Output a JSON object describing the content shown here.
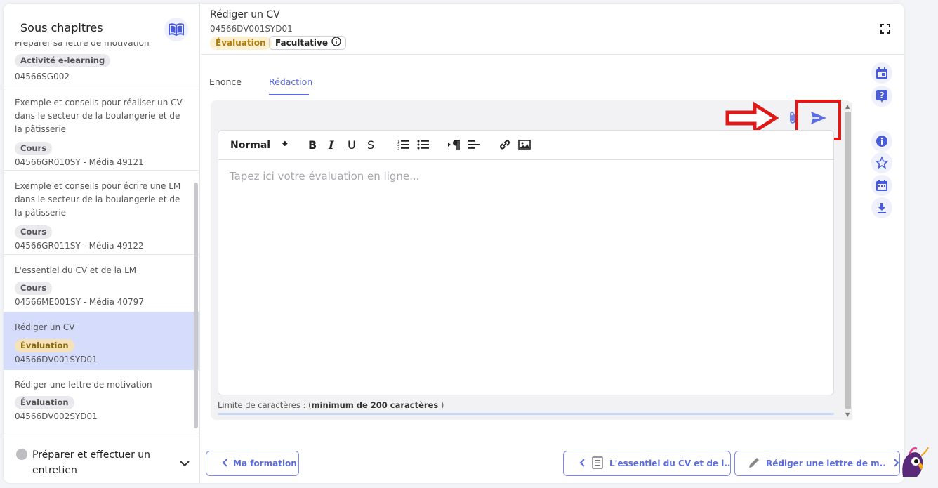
{
  "sidebar": {
    "title": "Sous chapitres",
    "items": [
      {
        "title": "Préparer sa lettre de motivation",
        "badge": "Activité e-learning",
        "code": "04566SG002"
      },
      {
        "title": "Exemple et conseils pour réaliser un CV dans le secteur de la boulangerie et de la pâtisserie",
        "badge": "Cours",
        "code": "04566GR010SY - Média 49121"
      },
      {
        "title": "Exemple et conseils pour écrire une LM dans le secteur de la boulangerie et de la pâtisserie",
        "badge": "Cours",
        "code": "04566GR011SY - Média 49122"
      },
      {
        "title": "L'essentiel du CV et de la LM",
        "badge": "Cours",
        "code": "04566ME001SY - Média 40797"
      },
      {
        "title": "Rédiger un CV",
        "badge": "Évaluation",
        "code": "04566DV001SYD01",
        "active": true
      },
      {
        "title": "Rédiger une lettre de motivation",
        "badge": "Évaluation",
        "code": "04566DV002SYD01"
      }
    ],
    "footer": {
      "label": "Préparer et effectuer un entretien"
    }
  },
  "header": {
    "title": "Rédiger un CV",
    "code": "04566DV001SYD01",
    "badge_eval": "Évaluation",
    "badge_optional": "Facultative"
  },
  "tabs": [
    {
      "label": "Enonce"
    },
    {
      "label": "Rédaction",
      "active": true
    }
  ],
  "editor": {
    "format_select": "Normal",
    "placeholder": "Tapez ici votre évaluation en ligne...",
    "limit_prefix": "Limite de caractères : (",
    "limit_bold": "minimum de 200 caractères",
    "limit_suffix": " )"
  },
  "nav": {
    "back_label": "Ma formation",
    "prev_label": "L'essentiel du CV et de l...",
    "next_label": "Rédiger une lettre de m..."
  },
  "colors": {
    "accent": "#5b6ce0",
    "highlight": "#e01818",
    "active_item": "#d6dcfb"
  }
}
